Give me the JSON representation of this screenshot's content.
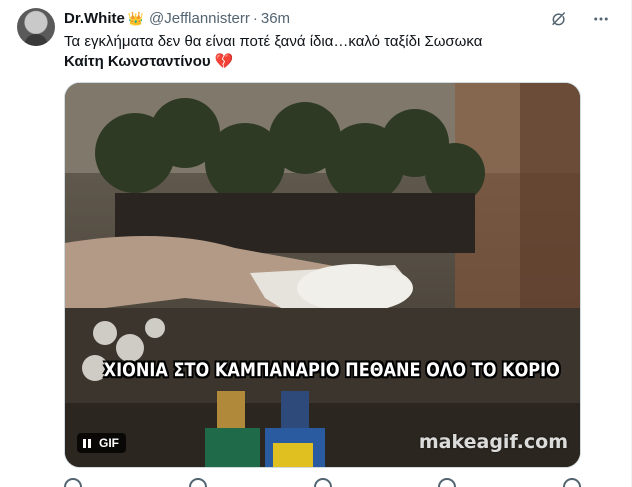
{
  "tweet": {
    "author_name": "Dr.White",
    "author_badge_icon": "crown-emoji",
    "handle": "@Jefflannisterr",
    "separator": "·",
    "time": "36m",
    "text_line1": "Τα εγκλήματα δεν θα είναι ποτέ ξανά ίδια…καλό ταξίδι Σωσωκα",
    "text_line2": "Καίτη Κωνσταντίνου",
    "text_line2_emoji": "💔",
    "actions": {
      "grok_icon": "grok-icon",
      "more_icon": "more-icon"
    }
  },
  "media": {
    "caption": "ΧΙΟΝΙΑ ΣΤΟ ΚΑΜΠΑΝΑΡΙΟ ΠΕΘΑΝΕ ΟΛΟ ΤΟ ΚΟΡΙΟ",
    "watermark": "makeagif.com",
    "gif_label": "GIF",
    "pause_icon": "pause-icon"
  },
  "colors": {
    "text_primary": "#0f1419",
    "text_secondary": "#536471",
    "border": "#cfd9de"
  }
}
